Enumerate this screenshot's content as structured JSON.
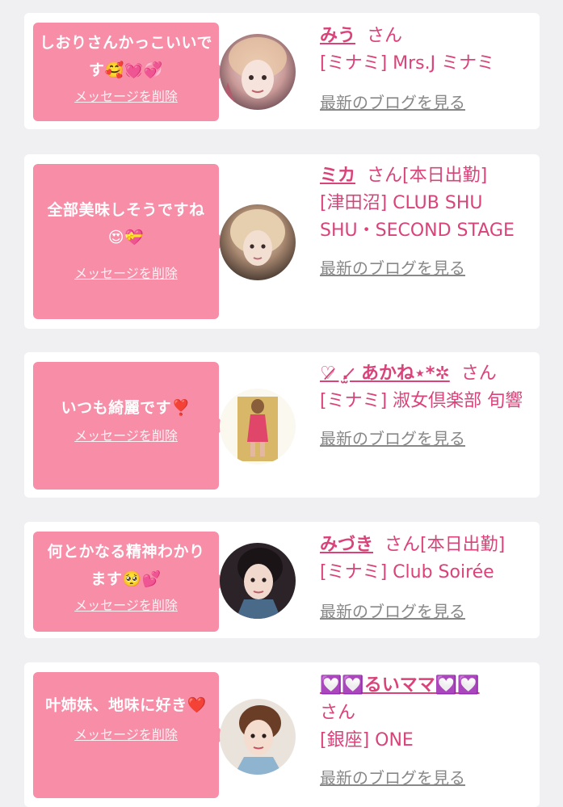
{
  "delete_label": "メッセージを削除",
  "blog_label": "最新のブログを見る",
  "san": "さん",
  "colors": {
    "bubble": "#f78da7",
    "accent": "#d9437a",
    "link_gray": "#888888",
    "background": "#f0f0f2"
  },
  "cards": [
    {
      "message": "しおりさんかっこいいです🥰💓💞",
      "name": "みう",
      "status": "",
      "shop": "[ミナミ] Mrs.J ミナミ"
    },
    {
      "message": "全部美味しそうですね😍💝",
      "name": "ミカ",
      "status": "[本日出勤]",
      "shop": "[津田沼] CLUB SHU SHU・SECOND STAGE"
    },
    {
      "message": "いつも綺麗です❣️",
      "name": "♡̷̷̷ .̫ ̷̷̷ あかね⋆*✲",
      "status": "",
      "shop": "[ミナミ] 淑女倶楽部 旬響"
    },
    {
      "message": "何とかなる精神わかります🥺💕",
      "name": "みづき",
      "status": "[本日出勤]",
      "shop": "[ミナミ] Club Soirée"
    },
    {
      "message": "叶姉妹、地味に好き❤️",
      "name": "💟💟るいママ💟💟",
      "status": "",
      "shop": "[銀座] ONE"
    }
  ]
}
